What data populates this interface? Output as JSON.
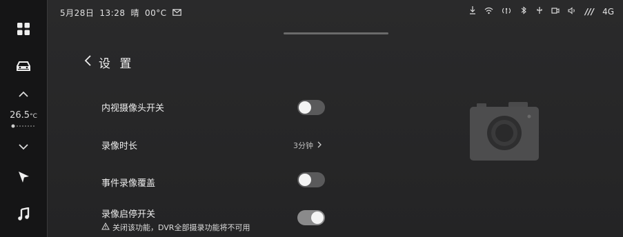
{
  "status": {
    "date": "5月28日",
    "time": "13:28",
    "weather": "晴",
    "temp": "00°C",
    "network": "4G",
    "signal": "///"
  },
  "dock": {
    "temperature": "26.5",
    "temperature_unit": "°C"
  },
  "header": {
    "title": "设 置"
  },
  "settings": {
    "camera_switch": {
      "label": "内视摄像头开关",
      "state": "off"
    },
    "record_duration": {
      "label": "录像时长",
      "value": "3分钟"
    },
    "event_overwrite": {
      "label": "事件录像覆盖",
      "state": "off"
    },
    "record_start_stop": {
      "label": "录像启停开关",
      "warning": "关闭该功能，DVR全部摄录功能将不可用",
      "state": "on"
    }
  },
  "colors": {
    "accent": "#f4f4f4",
    "toggle_off": "#5a5a5b",
    "toggle_on": "#8a8a8b"
  },
  "icons": [
    "apps-icon",
    "car-icon",
    "chevron-up-icon",
    "chevron-down-icon",
    "navigation-icon",
    "music-icon",
    "camera-icon",
    "warning-icon",
    "chevron-right-icon",
    "back-icon"
  ]
}
